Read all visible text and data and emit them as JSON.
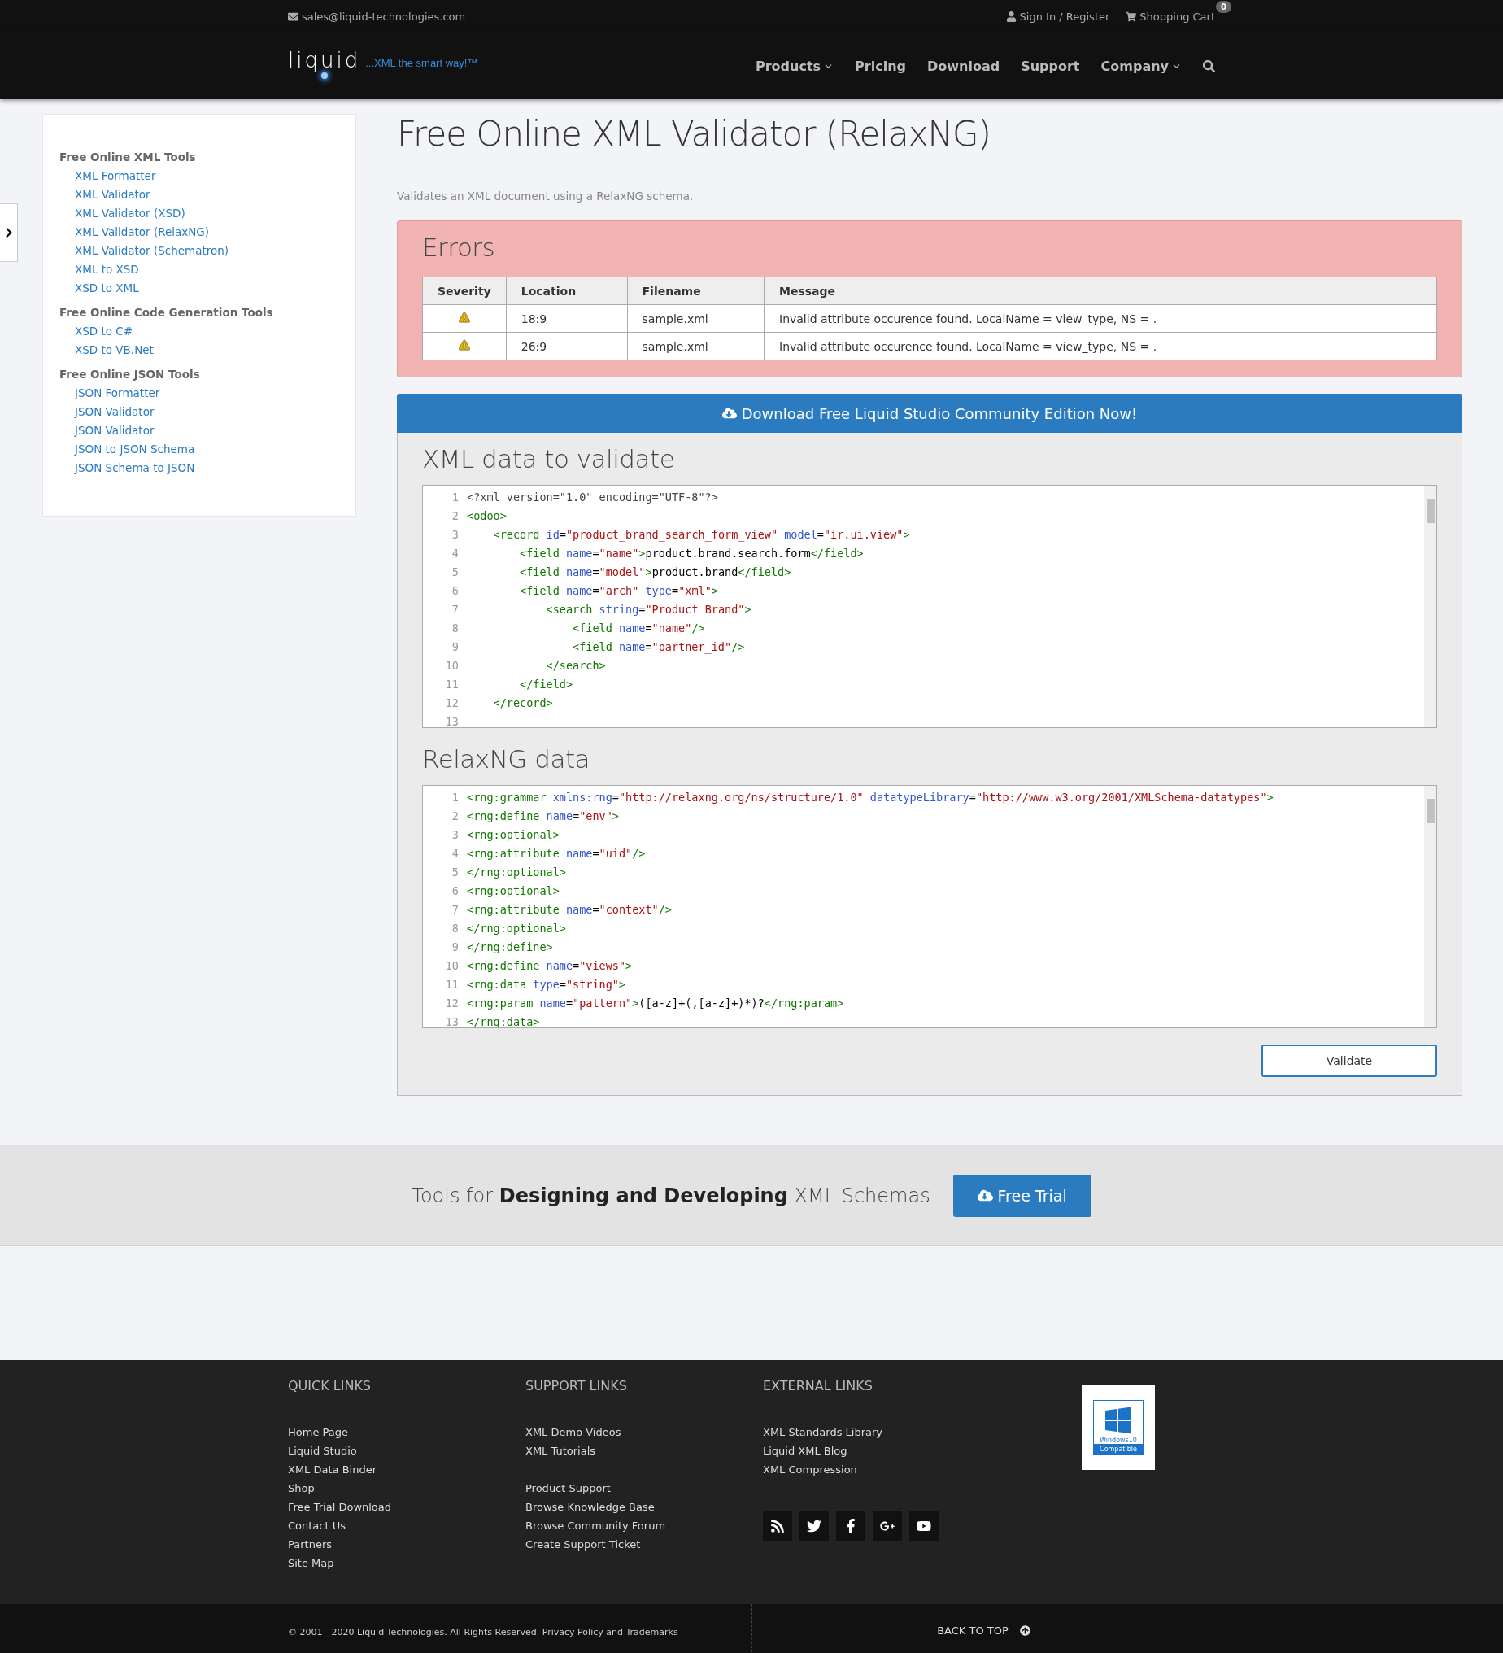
{
  "top_bar": {
    "email": "sales@liquid-technologies.com",
    "sign_in": "Sign In / Register",
    "cart": "Shopping Cart",
    "cart_count": "0"
  },
  "nav": {
    "logo": "liquid",
    "tagline": "...XML the smart way!™",
    "items": [
      {
        "label": "Products",
        "dropdown": true
      },
      {
        "label": "Pricing",
        "dropdown": false
      },
      {
        "label": "Download",
        "dropdown": false
      },
      {
        "label": "Support",
        "dropdown": false
      },
      {
        "label": "Company",
        "dropdown": true
      }
    ]
  },
  "sidebar": {
    "groups": [
      {
        "title": "Free Online XML Tools",
        "links": [
          "XML Formatter",
          "XML Validator",
          "XML Validator (XSD)",
          "XML Validator (RelaxNG)",
          "XML Validator (Schematron)",
          "XML to XSD",
          "XSD to XML"
        ]
      },
      {
        "title": "Free Online Code Generation Tools",
        "links": [
          "XSD to C#",
          "XSD to VB.Net"
        ]
      },
      {
        "title": "Free Online JSON Tools",
        "links": [
          "JSON Formatter",
          "JSON Validator",
          "JSON Validator",
          "JSON to JSON Schema",
          "JSON Schema to JSON"
        ]
      }
    ]
  },
  "page": {
    "title": "Free Online XML Validator (RelaxNG)",
    "description": "Validates an XML document using a RelaxNG schema."
  },
  "errors": {
    "title": "Errors",
    "columns": [
      "Severity",
      "Location",
      "Filename",
      "Message"
    ],
    "rows": [
      {
        "kind": "warning",
        "location": "18:9",
        "filename": "sample.xml",
        "message": "Invalid attribute occurence found. LocalName = view_type, NS = ."
      },
      {
        "kind": "warning",
        "location": "26:9",
        "filename": "sample.xml",
        "message": "Invalid attribute occurence found. LocalName = view_type, NS = ."
      }
    ]
  },
  "download_banner": "Download Free Liquid Studio Community Edition Now!",
  "editors": [
    {
      "title": "XML data to validate",
      "lines": [
        {
          "number": "1",
          "tokens": [
            {
              "kind": "meta",
              "text": "<?xml version=\"1.0\" encoding=\"UTF-8\"?>"
            }
          ]
        },
        {
          "number": "2",
          "tokens": [
            {
              "kind": "tag",
              "text": "<odoo>"
            }
          ]
        },
        {
          "number": "3",
          "tokens": [
            {
              "kind": "tag",
              "text": "    <record "
            },
            {
              "kind": "attr",
              "text": "id"
            },
            {
              "kind": "text",
              "text": "="
            },
            {
              "kind": "string",
              "text": "\"product_brand_search_form_view\""
            },
            {
              "kind": "attr",
              "text": " model"
            },
            {
              "kind": "text",
              "text": "="
            },
            {
              "kind": "string",
              "text": "\"ir.ui.view\""
            },
            {
              "kind": "tag",
              "text": ">"
            }
          ]
        },
        {
          "number": "4",
          "tokens": [
            {
              "kind": "tag",
              "text": "        <field "
            },
            {
              "kind": "attr",
              "text": "name"
            },
            {
              "kind": "text",
              "text": "="
            },
            {
              "kind": "string",
              "text": "\"name\""
            },
            {
              "kind": "tag",
              "text": ">"
            },
            {
              "kind": "text",
              "text": "product.brand.search.form"
            },
            {
              "kind": "tag",
              "text": "</field>"
            }
          ]
        },
        {
          "number": "5",
          "tokens": [
            {
              "kind": "tag",
              "text": "        <field "
            },
            {
              "kind": "attr",
              "text": "name"
            },
            {
              "kind": "text",
              "text": "="
            },
            {
              "kind": "string",
              "text": "\"model\""
            },
            {
              "kind": "tag",
              "text": ">"
            },
            {
              "kind": "text",
              "text": "product.brand"
            },
            {
              "kind": "tag",
              "text": "</field>"
            }
          ]
        },
        {
          "number": "6",
          "tokens": [
            {
              "kind": "tag",
              "text": "        <field "
            },
            {
              "kind": "attr",
              "text": "name"
            },
            {
              "kind": "text",
              "text": "="
            },
            {
              "kind": "string",
              "text": "\"arch\""
            },
            {
              "kind": "attr",
              "text": " type"
            },
            {
              "kind": "text",
              "text": "="
            },
            {
              "kind": "string",
              "text": "\"xml\""
            },
            {
              "kind": "tag",
              "text": ">"
            }
          ]
        },
        {
          "number": "7",
          "tokens": [
            {
              "kind": "tag",
              "text": "            <search "
            },
            {
              "kind": "attr",
              "text": "string"
            },
            {
              "kind": "text",
              "text": "="
            },
            {
              "kind": "string",
              "text": "\"Product Brand\""
            },
            {
              "kind": "tag",
              "text": ">"
            }
          ]
        },
        {
          "number": "8",
          "tokens": [
            {
              "kind": "tag",
              "text": "                <field "
            },
            {
              "kind": "attr",
              "text": "name"
            },
            {
              "kind": "text",
              "text": "="
            },
            {
              "kind": "string",
              "text": "\"name\""
            },
            {
              "kind": "tag",
              "text": "/>"
            }
          ]
        },
        {
          "number": "9",
          "tokens": [
            {
              "kind": "tag",
              "text": "                <field "
            },
            {
              "kind": "attr",
              "text": "name"
            },
            {
              "kind": "text",
              "text": "="
            },
            {
              "kind": "string",
              "text": "\"partner_id\""
            },
            {
              "kind": "tag",
              "text": "/>"
            }
          ]
        },
        {
          "number": "10",
          "tokens": [
            {
              "kind": "tag",
              "text": "            </search>"
            }
          ]
        },
        {
          "number": "11",
          "tokens": [
            {
              "kind": "tag",
              "text": "        </field>"
            }
          ]
        },
        {
          "number": "12",
          "tokens": [
            {
              "kind": "tag",
              "text": "    </record>"
            }
          ]
        },
        {
          "number": "13"
        }
      ]
    },
    {
      "title": "RelaxNG data",
      "lines": [
        {
          "number": "1",
          "tokens": [
            {
              "kind": "tag",
              "text": "<rng:grammar "
            },
            {
              "kind": "attr",
              "text": "xmlns:rng"
            },
            {
              "kind": "text",
              "text": "="
            },
            {
              "kind": "string",
              "text": "\"http://relaxng.org/ns/structure/1.0\""
            },
            {
              "kind": "attr",
              "text": " datatypeLibrary"
            },
            {
              "kind": "text",
              "text": "="
            },
            {
              "kind": "string",
              "text": "\"http://www.w3.org/2001/XMLSchema-datatypes\""
            },
            {
              "kind": "tag",
              "text": ">"
            }
          ]
        },
        {
          "number": "2",
          "tokens": [
            {
              "kind": "tag",
              "text": "<rng:define "
            },
            {
              "kind": "attr",
              "text": "name"
            },
            {
              "kind": "text",
              "text": "="
            },
            {
              "kind": "string",
              "text": "\"env\""
            },
            {
              "kind": "tag",
              "text": ">"
            }
          ]
        },
        {
          "number": "3",
          "tokens": [
            {
              "kind": "tag",
              "text": "<rng:optional>"
            }
          ]
        },
        {
          "number": "4",
          "tokens": [
            {
              "kind": "tag",
              "text": "<rng:attribute "
            },
            {
              "kind": "attr",
              "text": "name"
            },
            {
              "kind": "text",
              "text": "="
            },
            {
              "kind": "string",
              "text": "\"uid\""
            },
            {
              "kind": "tag",
              "text": "/>"
            }
          ]
        },
        {
          "number": "5",
          "tokens": [
            {
              "kind": "tag",
              "text": "</rng:optional>"
            }
          ]
        },
        {
          "number": "6",
          "tokens": [
            {
              "kind": "tag",
              "text": "<rng:optional>"
            }
          ]
        },
        {
          "number": "7",
          "tokens": [
            {
              "kind": "tag",
              "text": "<rng:attribute "
            },
            {
              "kind": "attr",
              "text": "name"
            },
            {
              "kind": "text",
              "text": "="
            },
            {
              "kind": "string",
              "text": "\"context\""
            },
            {
              "kind": "tag",
              "text": "/>"
            }
          ]
        },
        {
          "number": "8",
          "tokens": [
            {
              "kind": "tag",
              "text": "</rng:optional>"
            }
          ]
        },
        {
          "number": "9",
          "tokens": [
            {
              "kind": "tag",
              "text": "</rng:define>"
            }
          ]
        },
        {
          "number": "10",
          "tokens": [
            {
              "kind": "tag",
              "text": "<rng:define "
            },
            {
              "kind": "attr",
              "text": "name"
            },
            {
              "kind": "text",
              "text": "="
            },
            {
              "kind": "string",
              "text": "\"views\""
            },
            {
              "kind": "tag",
              "text": ">"
            }
          ]
        },
        {
          "number": "11",
          "tokens": [
            {
              "kind": "tag",
              "text": "<rng:data "
            },
            {
              "kind": "attr",
              "text": "type"
            },
            {
              "kind": "text",
              "text": "="
            },
            {
              "kind": "string",
              "text": "\"string\""
            },
            {
              "kind": "tag",
              "text": ">"
            }
          ]
        },
        {
          "number": "12",
          "tokens": [
            {
              "kind": "tag",
              "text": "<rng:param "
            },
            {
              "kind": "attr",
              "text": "name"
            },
            {
              "kind": "text",
              "text": "="
            },
            {
              "kind": "string",
              "text": "\"pattern\""
            },
            {
              "kind": "tag",
              "text": ">"
            },
            {
              "kind": "text",
              "text": "([a-z]+(,[a-z]+)*)?"
            },
            {
              "kind": "tag",
              "text": "</rng:param>"
            }
          ]
        },
        {
          "number": "13",
          "tokens": [
            {
              "kind": "tag",
              "text": "</rng:data>"
            }
          ]
        }
      ]
    }
  ],
  "validate_button": "Validate",
  "cta": {
    "text": "Tools for **Designing and Developing** XML Schemas",
    "button": "Free Trial"
  },
  "footer": {
    "columns": [
      {
        "title": "QUICK LINKS",
        "sections": [
          [
            "Home Page",
            "Liquid Studio",
            "XML Data Binder",
            "Shop",
            "Free Trial Download",
            "Contact Us",
            "Partners",
            "Site Map"
          ]
        ]
      },
      {
        "title": "SUPPORT LINKS",
        "sections": [
          [
            "XML Demo Videos",
            "XML Tutorials"
          ],
          [
            "Product Support",
            "Browse Knowledge Base",
            "Browse Community Forum",
            "Create Support Ticket"
          ]
        ]
      },
      {
        "title": "EXTERNAL LINKS",
        "sections": [
          [
            "XML Standards Library",
            "Liquid XML Blog",
            "XML Compression"
          ]
        ]
      }
    ],
    "social": [
      {
        "kind": "rss"
      },
      {
        "kind": "twitter"
      },
      {
        "kind": "facebook"
      },
      {
        "kind": "google"
      },
      {
        "kind": "youtube"
      }
    ],
    "badge": {
      "line1": "Windows10",
      "line2": "Compatible"
    },
    "copyright": "© 2001 - 2020 Liquid Technologies. All Rights Reserved. Privacy Policy and Trademarks",
    "back_to_top": "BACK TO TOP"
  }
}
